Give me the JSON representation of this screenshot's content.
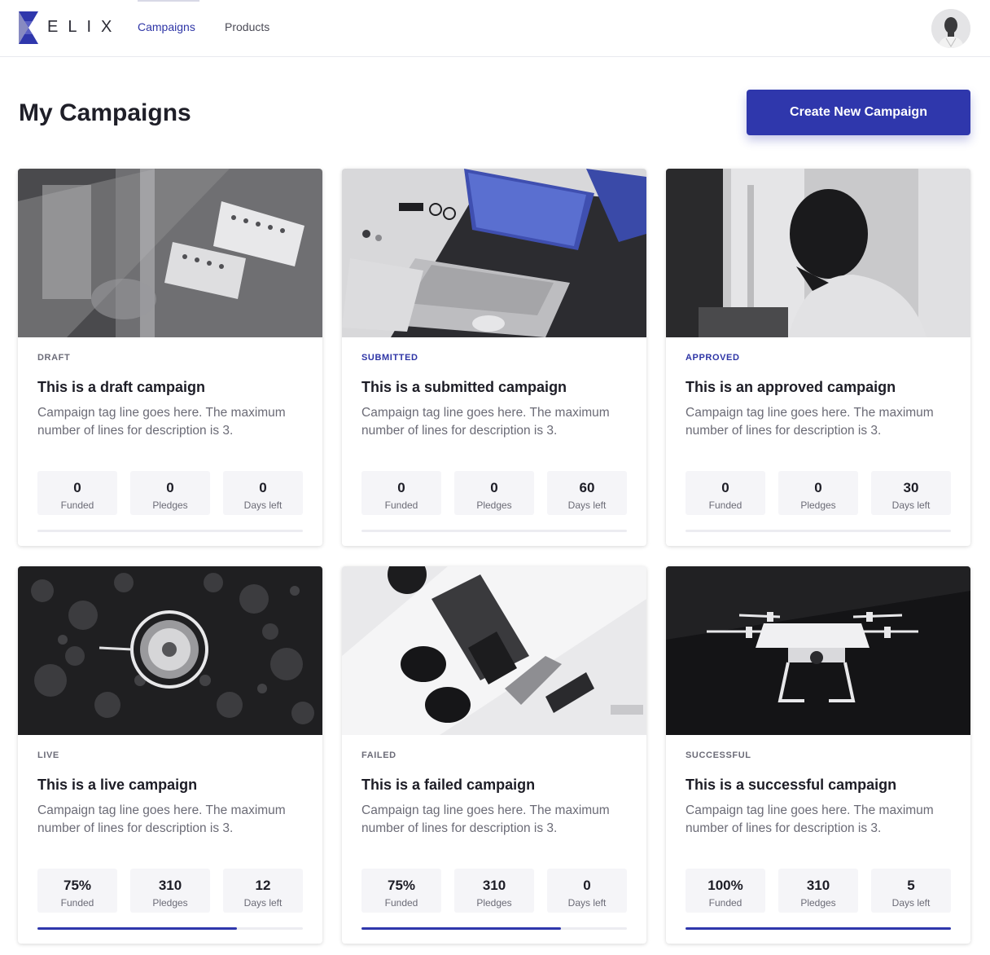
{
  "brand": {
    "logo_text": "ELIX"
  },
  "nav": {
    "items": [
      {
        "label": "Campaigns"
      },
      {
        "label": "Products"
      }
    ]
  },
  "page": {
    "title": "My Campaigns",
    "create_button": "Create New Campaign"
  },
  "colors": {
    "accent": "#2f37ac",
    "status_blue": "#2e35a6",
    "stat_bg": "#f5f5f8"
  },
  "campaigns": [
    {
      "status": "DRAFT",
      "title": "This is a draft campaign",
      "desc": "Campaign tag line goes here. The maximum number of lines for description is 3.",
      "image": "lab-test-tubes",
      "stats": [
        {
          "value": "0",
          "label": "Funded"
        },
        {
          "value": "0",
          "label": "Pledges"
        },
        {
          "value": "0",
          "label": "Days left"
        }
      ],
      "progress": 0
    },
    {
      "status": "SUBMITTED",
      "title": "This is a submitted campaign",
      "desc": "Campaign tag line goes here. The maximum number of lines for description is 3.",
      "image": "laptop-desk",
      "stats": [
        {
          "value": "0",
          "label": "Funded"
        },
        {
          "value": "0",
          "label": "Pledges"
        },
        {
          "value": "60",
          "label": "Days left"
        }
      ],
      "progress": 0
    },
    {
      "status": "APPROVED",
      "title": "This is an approved campaign",
      "desc": "Campaign tag line goes here. The maximum number of lines for description is 3.",
      "image": "person-window",
      "stats": [
        {
          "value": "0",
          "label": "Funded"
        },
        {
          "value": "0",
          "label": "Pledges"
        },
        {
          "value": "30",
          "label": "Days left"
        }
      ],
      "progress": 0
    },
    {
      "status": "LIVE",
      "title": "This is a live campaign",
      "desc": "Campaign tag line goes here. The maximum number of lines for description is 3.",
      "image": "aerial-tower",
      "stats": [
        {
          "value": "75%",
          "label": "Funded"
        },
        {
          "value": "310",
          "label": "Pledges"
        },
        {
          "value": "12",
          "label": "Days left"
        }
      ],
      "progress": 0.75
    },
    {
      "status": "FAILED",
      "title": "This is a failed campaign",
      "desc": "Campaign tag line goes here. The maximum number of lines for description is 3.",
      "image": "flatlay-gadgets",
      "stats": [
        {
          "value": "75%",
          "label": "Funded"
        },
        {
          "value": "310",
          "label": "Pledges"
        },
        {
          "value": "0",
          "label": "Days left"
        }
      ],
      "progress": 0.75
    },
    {
      "status": "SUCCESSFUL",
      "title": "This is a successful campaign",
      "desc": "Campaign tag line goes here. The maximum number of lines for description is 3.",
      "image": "drone",
      "stats": [
        {
          "value": "100%",
          "label": "Funded"
        },
        {
          "value": "310",
          "label": "Pledges"
        },
        {
          "value": "5",
          "label": "Days left"
        }
      ],
      "progress": 1.0
    }
  ]
}
